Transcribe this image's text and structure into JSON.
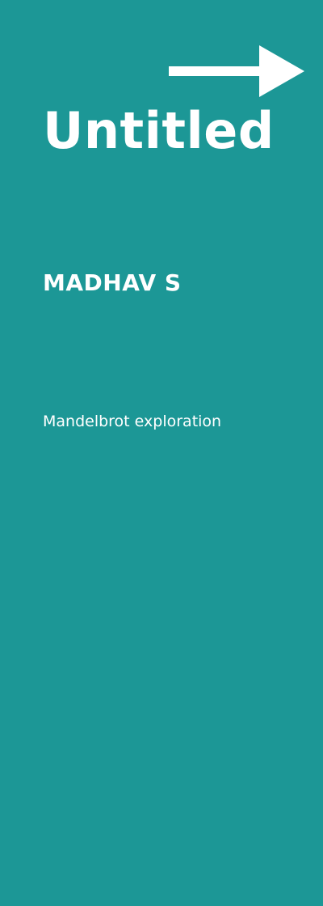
{
  "colors": {
    "background": "#1c9796",
    "text": "#ffffff"
  },
  "header": {
    "next_icon": "arrow-right-icon"
  },
  "content": {
    "title": "Untitled",
    "author": "MADHAV S",
    "subtitle": "Mandelbrot exploration"
  }
}
